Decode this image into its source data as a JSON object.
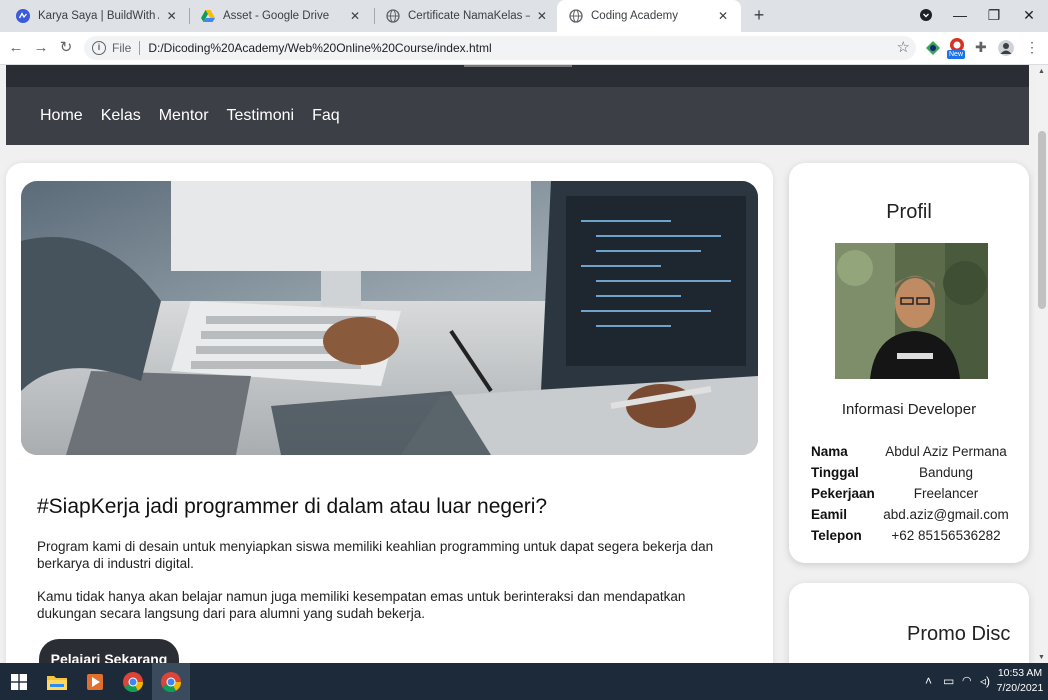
{
  "browser": {
    "tabs": [
      {
        "title": "Karya Saya | BuildWith Angga",
        "icon": "buildwithangga-icon",
        "active": false
      },
      {
        "title": "Asset - Google Drive",
        "icon": "google-drive-icon",
        "active": false
      },
      {
        "title": "Certificate NamaKelas — BWA",
        "icon": "globe-icon",
        "active": false
      },
      {
        "title": "Coding Academy",
        "icon": "globe-icon",
        "active": true
      }
    ],
    "new_tab_label": "+",
    "address": {
      "scheme_label": "File",
      "url": "D:/Dicoding%20Academy/Web%20Online%20Course/index.html"
    },
    "extension_badge": "New"
  },
  "navbar": {
    "links": [
      "Home",
      "Kelas",
      "Mentor",
      "Testimoni",
      "Faq"
    ]
  },
  "main": {
    "headline": "#SiapKerja jadi programmer di dalam atau luar negeri?",
    "paragraph_1": "Program kami di desain untuk menyiapkan siswa memiliki keahlian programming untuk dapat segera bekerja dan berkarya di industri digital.",
    "paragraph_2": "Kamu tidak hanya akan belajar namun juga memiliki kesempatan emas untuk berinteraksi dan mendapatkan dukungan secara langsung dari para alumni yang sudah bekerja.",
    "cta_label": "Pelajari Sekarang"
  },
  "profile": {
    "title": "Profil",
    "subtitle": "Informasi Developer",
    "rows": [
      {
        "key": "Nama",
        "value": "Abdul Aziz Permana"
      },
      {
        "key": "Tinggal",
        "value": "Bandung"
      },
      {
        "key": "Pekerjaan",
        "value": "Freelancer"
      },
      {
        "key": "Eamil",
        "value": "abd.aziz@gmail.com"
      },
      {
        "key": "Telepon",
        "value": "+62 85156536282"
      }
    ]
  },
  "promo": {
    "title": "Promo Disc"
  },
  "taskbar": {
    "time": "10:53 AM",
    "date": "7/20/2021"
  },
  "colors": {
    "navbar_bg": "#3c3f46",
    "header_bg": "#2a2d33",
    "cta_bg": "#2a2d33",
    "page_bg": "#f0f0f0",
    "taskbar_bg": "#1d2a3a"
  }
}
